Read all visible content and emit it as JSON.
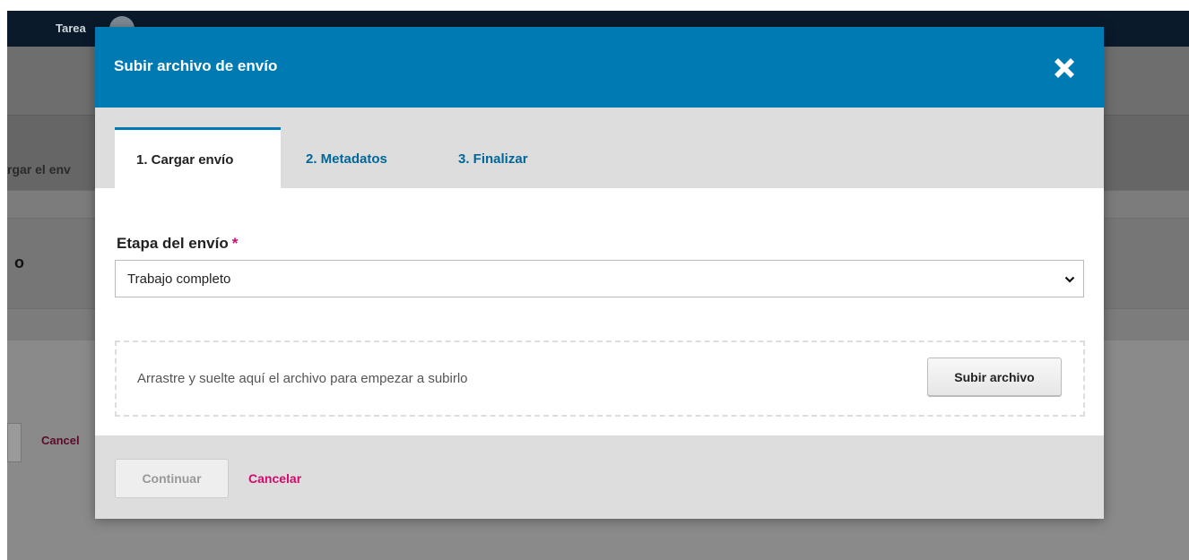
{
  "background": {
    "topbar_task_label": "Tarea",
    "tab_partial_label": "rgar el env",
    "heading_partial": "o",
    "cancel_partial": "Cancel"
  },
  "modal": {
    "title": "Subir archivo de envío",
    "close_icon": "close-icon",
    "tabs": [
      {
        "label": "1. Cargar envío",
        "active": true
      },
      {
        "label": "2. Metadatos",
        "active": false
      },
      {
        "label": "3. Finalizar",
        "active": false
      }
    ],
    "stage_field": {
      "label": "Etapa del envío",
      "required_marker": "*",
      "selected_value": "Trabajo completo"
    },
    "dropzone": {
      "hint": "Arrastre y suelte aquí el archivo para empezar a subirlo",
      "upload_button_label": "Subir archivo"
    },
    "footer": {
      "continue_label": "Continuar",
      "cancel_label": "Cancelar"
    }
  },
  "colors": {
    "header": "#007ab2",
    "tab_link": "#006798",
    "required": "#d00a6c",
    "cancel": "#d00a6c"
  }
}
